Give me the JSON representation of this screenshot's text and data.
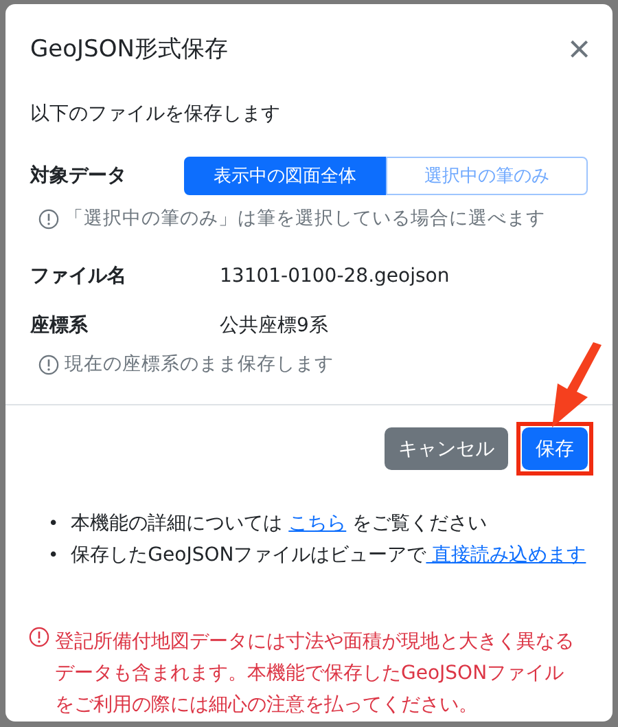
{
  "dialog": {
    "title": "GeoJSON形式保存",
    "close_icon": "×",
    "intro": "以下のファイルを保存します",
    "target": {
      "label": "対象データ",
      "options": [
        {
          "label": "表示中の図面全体",
          "selected": true
        },
        {
          "label": "選択中の筆のみ",
          "selected": false
        }
      ],
      "hint": "「選択中の筆のみ」は筆を選択している場合に選べます"
    },
    "fields": [
      {
        "label": "ファイル名",
        "value": "13101-0100-28.geojson"
      },
      {
        "label": "座標系",
        "value": "公共座標9系"
      }
    ],
    "coordinate_hint": "現在の座標系のまま保存します",
    "buttons": [
      {
        "label": "キャンセル",
        "kind": "secondary",
        "highlighted": false
      },
      {
        "label": "保存",
        "kind": "primary",
        "highlighted": true
      }
    ],
    "notes": [
      {
        "bullet": "•",
        "text": "本機能の詳細については ",
        "link": "こちら",
        "after": " をご覧ください"
      },
      {
        "bullet": "•",
        "text": "保存したGeoJSONファイルはビューアで",
        "link": " 直接読み込めます"
      }
    ],
    "warning": "登記所備付地図データには寸法や面積が現地と大きく異なるデータも含まれます。本機能で保存したGeoJSONファイルをご利用の際には細心の注意を払ってください。"
  }
}
